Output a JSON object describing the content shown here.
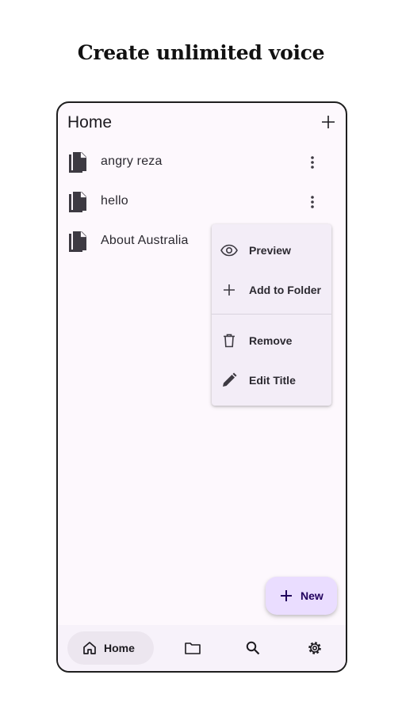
{
  "headline": "Create unlimited voice",
  "app_bar": {
    "title": "Home",
    "add_icon": "plus-icon"
  },
  "files": [
    {
      "name": "angry reza",
      "icon": "document-icon",
      "menu_icon": "more-vert-icon"
    },
    {
      "name": "hello",
      "icon": "document-icon",
      "menu_icon": "more-vert-icon"
    },
    {
      "name": "About Australia",
      "icon": "document-icon"
    }
  ],
  "context_menu": {
    "items": [
      {
        "label": "Preview",
        "icon": "eye-icon"
      },
      {
        "label": "Add to Folder",
        "icon": "plus-icon"
      },
      {
        "label": "Remove",
        "icon": "trash-icon"
      },
      {
        "label": "Edit Title",
        "icon": "pencil-icon"
      }
    ]
  },
  "fab": {
    "label": "New",
    "icon": "plus-icon"
  },
  "bottom_nav": {
    "items": [
      {
        "label": "Home",
        "icon": "home-icon",
        "selected": true
      },
      {
        "label": "",
        "icon": "folder-icon",
        "selected": false
      },
      {
        "label": "",
        "icon": "search-icon",
        "selected": false
      },
      {
        "label": "",
        "icon": "gear-icon",
        "selected": false
      }
    ]
  },
  "colors": {
    "surface": "#fdf8fd",
    "menu_surface": "#f3edf7",
    "fab_container": "#eaddff",
    "nav_surface": "#f7f2fa",
    "nav_indicator": "#ece6ef",
    "on_surface": "#1d1b20"
  }
}
